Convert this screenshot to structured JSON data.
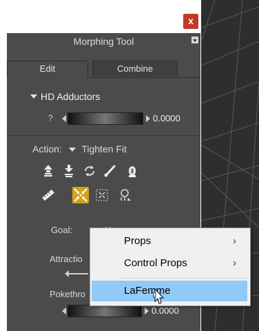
{
  "window": {
    "close_label": "x"
  },
  "panel": {
    "title": "Morphing Tool"
  },
  "tabs": [
    {
      "label": "Edit"
    },
    {
      "label": "Combine"
    }
  ],
  "hd_section": {
    "title": "HD Adductors",
    "help": "?",
    "value": "0.0000"
  },
  "action": {
    "label": "Action:",
    "value": "Tighten Fit"
  },
  "tool_icons": {
    "row1": [
      "push-up-icon",
      "push-down-icon",
      "smooth-icon",
      "brush-icon",
      "restore-icon"
    ],
    "row2": [
      "ruler-icon",
      "tighten-fit-icon",
      "bounding-box-icon",
      "magnet-icon"
    ],
    "selected": "tighten-fit-icon"
  },
  "goal": {
    "label": "Goal:",
    "value_partial": "N"
  },
  "attraction": {
    "label": "Attractio"
  },
  "pokethrough": {
    "label": "Pokethro",
    "value": "0.0000"
  },
  "context_menu": {
    "items": [
      {
        "label": "Props",
        "submenu": true
      },
      {
        "label": "Control Props",
        "submenu": true
      },
      {
        "label": "LaFemme",
        "submenu": false,
        "highlighted": true
      }
    ],
    "chevron": "›"
  },
  "colors": {
    "panel_bg": "#4b4b4b",
    "highlight": "#91c9f7",
    "selected_tool": "#d4a21a",
    "close_button": "#c0392b"
  }
}
